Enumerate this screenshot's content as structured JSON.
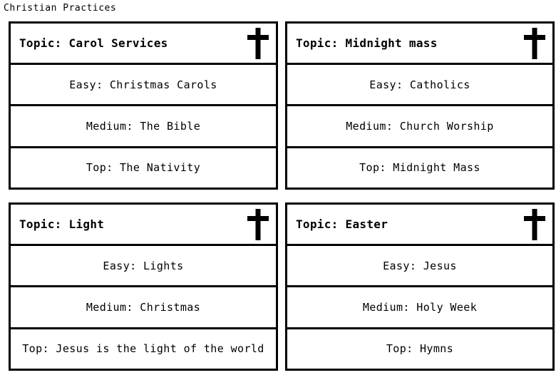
{
  "page": {
    "title": "Christian Practices"
  },
  "icons": {
    "cross": "cross-icon"
  },
  "cards": [
    {
      "header": "Topic: Carol Services",
      "icon": "cross-icon",
      "rows": [
        "Easy: Christmas Carols",
        "Medium: The Bible",
        "Top: The Nativity"
      ]
    },
    {
      "header": "Topic: Midnight mass",
      "icon": "cross-icon",
      "rows": [
        "Easy: Catholics",
        "Medium: Church Worship",
        "Top: Midnight Mass"
      ]
    },
    {
      "header": "Topic: Light",
      "icon": "cross-icon",
      "rows": [
        "Easy: Lights",
        "Medium: Christmas",
        "Top: Jesus is the light of the world"
      ]
    },
    {
      "header": "Topic: Easter",
      "icon": "cross-icon",
      "rows": [
        "Easy: Jesus",
        "Medium: Holy Week",
        "Top: Hymns"
      ]
    }
  ],
  "colors": {
    "border": "#000000",
    "text": "#000000",
    "background": "#ffffff"
  }
}
